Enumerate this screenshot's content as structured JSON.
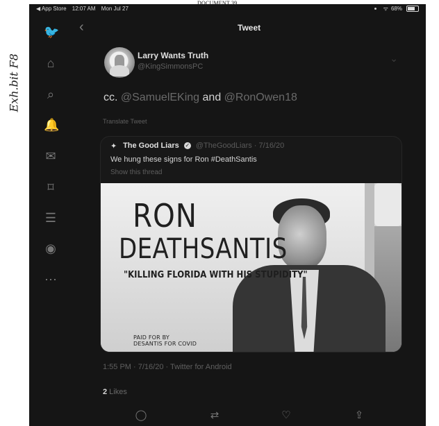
{
  "document_label": "DOCUMENT 39",
  "exhibit_label": "Exh.bit F8",
  "status_bar": {
    "back_to": "◀ App Store",
    "time": "12:07 AM",
    "date": "Mon Jul 27",
    "wifi": "ᯤ",
    "battery": "68%"
  },
  "header": {
    "title": "Tweet",
    "back": "‹"
  },
  "sidebar": {
    "icons": [
      {
        "name": "twitter-icon",
        "glyph": "🐦"
      },
      {
        "name": "home-icon",
        "glyph": "⌂"
      },
      {
        "name": "search-icon",
        "glyph": "⌕"
      },
      {
        "name": "notifications-icon",
        "glyph": "🔔"
      },
      {
        "name": "messages-icon",
        "glyph": "✉"
      },
      {
        "name": "bookmarks-icon",
        "glyph": "⌑"
      },
      {
        "name": "lists-icon",
        "glyph": "☰"
      },
      {
        "name": "profile-icon",
        "glyph": "◉"
      },
      {
        "name": "more-icon",
        "glyph": "⋯"
      }
    ]
  },
  "tweet": {
    "author_name": "Larry Wants Truth",
    "author_handle": "@KingSimmonsPC",
    "text_prefix": "cc. ",
    "mention_1": "@SamuelEKing",
    "text_middle": " and ",
    "mention_2": "@RonOwen18",
    "translate": "Translate Tweet",
    "more": "⌄"
  },
  "quoted_tweet": {
    "name": "The Good Liars",
    "handle": "@TheGoodLiars",
    "date": " · 7/16/20",
    "text": "We hung these signs for Ron #DeathSantis",
    "show_thread": "Show this thread",
    "image": {
      "line_1": "RON",
      "line_2": "DEATHSANTIS",
      "line_3": "\"KILLING FLORIDA WITH HIS STUPIDITY\"",
      "paid_for_1": "PAID FOR BY",
      "paid_for_2": "DESANTIS FOR COVID"
    }
  },
  "meta": {
    "timestamp": "1:55 PM · 7/16/20 · Twitter for Android"
  },
  "likes": {
    "count": "2",
    "label": " Likes"
  },
  "actions": [
    {
      "name": "reply-icon",
      "glyph": "◯"
    },
    {
      "name": "retweet-icon",
      "glyph": "⇄"
    },
    {
      "name": "like-icon",
      "glyph": "♡"
    },
    {
      "name": "share-icon",
      "glyph": "⇪"
    }
  ]
}
